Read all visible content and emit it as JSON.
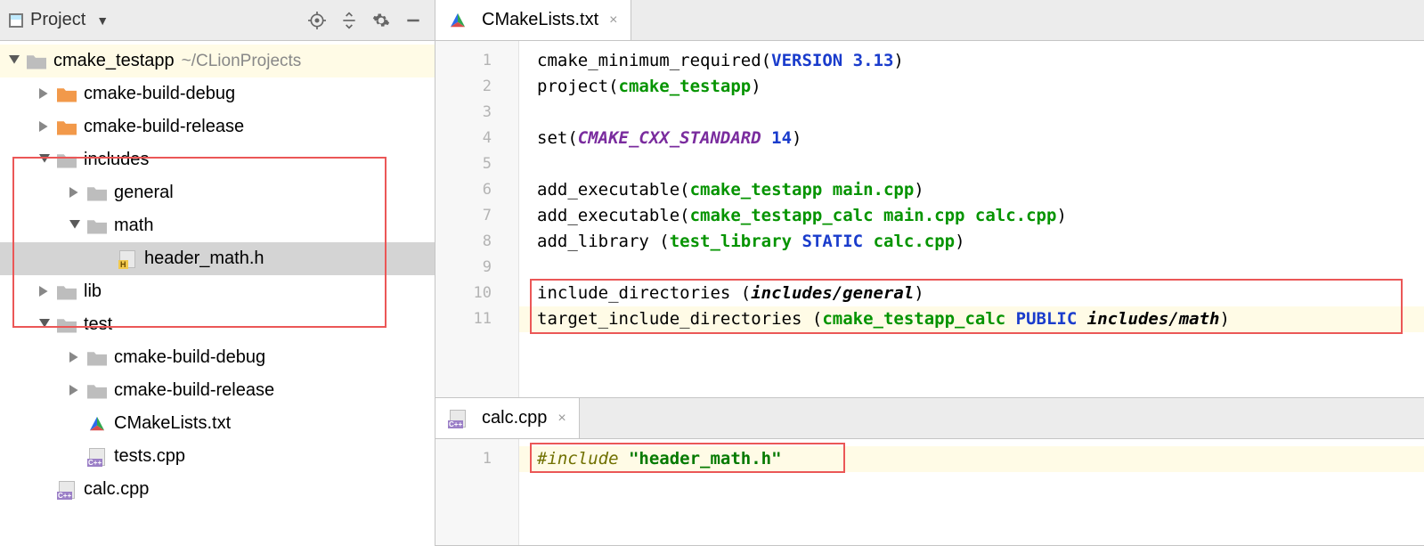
{
  "toolbar": {
    "title": "Project"
  },
  "tree": {
    "root": {
      "label": "cmake_testapp",
      "path": "~/CLionProjects"
    },
    "items": [
      {
        "label": "cmake-build-debug",
        "type": "folder-orange",
        "indent": 1,
        "arrow": "right"
      },
      {
        "label": "cmake-build-release",
        "type": "folder-orange",
        "indent": 1,
        "arrow": "right"
      },
      {
        "label": "includes",
        "type": "folder-grey",
        "indent": 1,
        "arrow": "down"
      },
      {
        "label": "general",
        "type": "folder-grey",
        "indent": 2,
        "arrow": "right"
      },
      {
        "label": "math",
        "type": "folder-grey",
        "indent": 2,
        "arrow": "down"
      },
      {
        "label": "header_math.h",
        "type": "hfile",
        "indent": 3,
        "arrow": "none",
        "selected": true
      },
      {
        "label": "lib",
        "type": "folder-grey",
        "indent": 1,
        "arrow": "right"
      },
      {
        "label": "test",
        "type": "folder-grey",
        "indent": 1,
        "arrow": "down"
      },
      {
        "label": "cmake-build-debug",
        "type": "folder-grey",
        "indent": 2,
        "arrow": "right"
      },
      {
        "label": "cmake-build-release",
        "type": "folder-grey",
        "indent": 2,
        "arrow": "right"
      },
      {
        "label": "CMakeLists.txt",
        "type": "cmake",
        "indent": 2,
        "arrow": "none"
      },
      {
        "label": "tests.cpp",
        "type": "cppfile",
        "indent": 2,
        "arrow": "none"
      },
      {
        "label": "calc.cpp",
        "type": "cppfile",
        "indent": 1,
        "arrow": "none"
      }
    ]
  },
  "editor_top": {
    "tab": "CMakeLists.txt",
    "lines": [
      "1",
      "2",
      "3",
      "4",
      "5",
      "6",
      "7",
      "8",
      "9",
      "10",
      "11"
    ],
    "code": {
      "l1": {
        "fn": "cmake_minimum_required",
        "kw": "VERSION",
        "ver": "3.13"
      },
      "l2": {
        "fn": "project",
        "arg": "cmake_testapp"
      },
      "l4": {
        "fn": "set",
        "var": "CMAKE_CXX_STANDARD",
        "val": "14"
      },
      "l6": {
        "fn": "add_executable",
        "tgt": "cmake_testapp",
        "src": "main.cpp"
      },
      "l7": {
        "fn": "add_executable",
        "tgt": "cmake_testapp_calc",
        "src": "main.cpp calc.cpp"
      },
      "l8": {
        "fn": "add_library",
        "tgt": "test_library",
        "kw": "STATIC",
        "src": "calc.cpp"
      },
      "l10": {
        "fn": "include_directories",
        "path": "includes/general"
      },
      "l11": {
        "fn": "target_include_directories",
        "tgt": "cmake_testapp_calc",
        "kw": "PUBLIC",
        "path": "includes/math"
      }
    }
  },
  "editor_bottom": {
    "tab": "calc.cpp",
    "lines": [
      "1"
    ],
    "code": {
      "l1": {
        "inc": "#include",
        "hdr": "\"header_math.h\""
      }
    }
  }
}
